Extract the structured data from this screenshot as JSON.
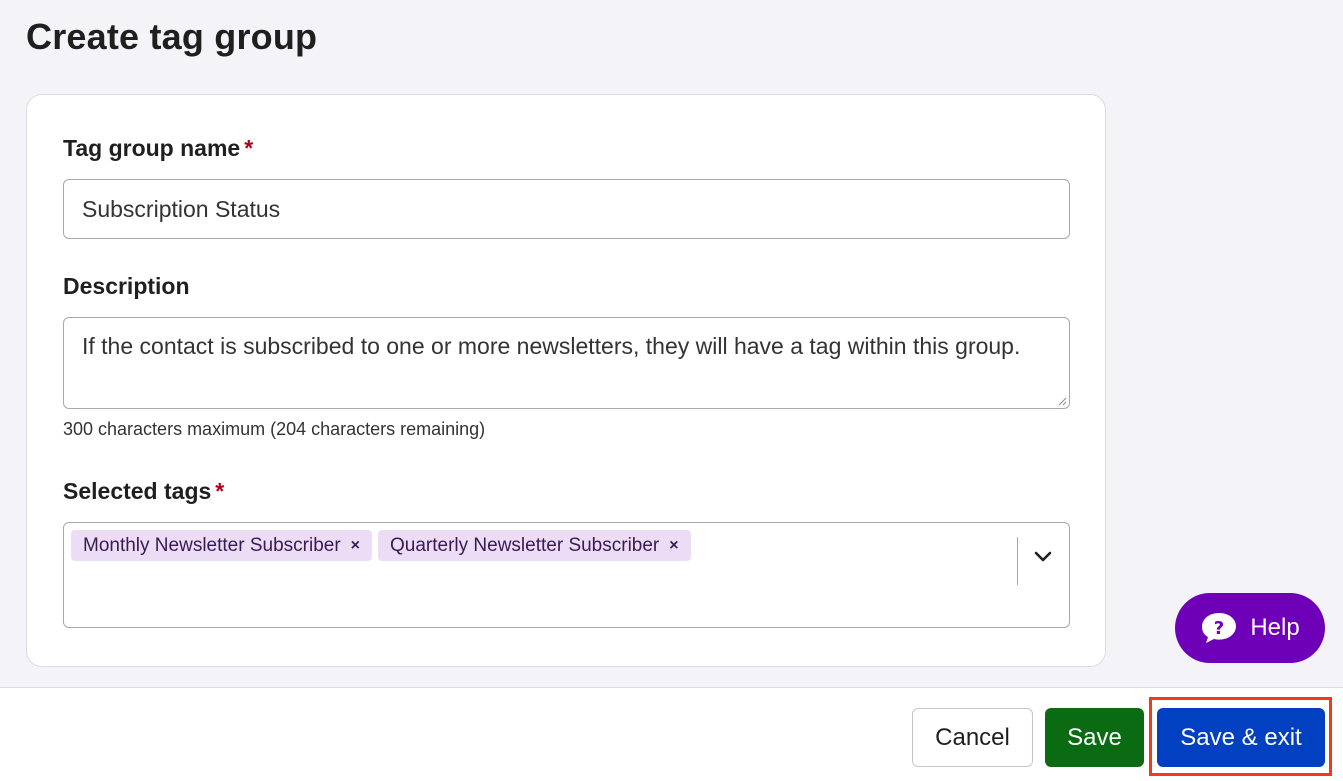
{
  "page": {
    "title": "Create tag group"
  },
  "form": {
    "name": {
      "label": "Tag group name",
      "required_mark": "*",
      "value": "Subscription Status"
    },
    "description": {
      "label": "Description",
      "value": "If the contact is subscribed to one or more newsletters, they will have a tag within this group.",
      "helper": "300 characters maximum (204 characters remaining)"
    },
    "tags": {
      "label": "Selected tags",
      "required_mark": "*",
      "selected": [
        {
          "label": "Monthly Newsletter Subscriber",
          "remove": "×"
        },
        {
          "label": "Quarterly Newsletter Subscriber",
          "remove": "×"
        }
      ]
    }
  },
  "help": {
    "label": "Help",
    "icon": "question-bubble-icon"
  },
  "footer": {
    "cancel": "Cancel",
    "save": "Save",
    "save_exit": "Save & exit"
  },
  "colors": {
    "primary": "#0040c1",
    "save": "#0b6b12",
    "help": "#6e00b8",
    "chip": "#ecdcf6",
    "required": "#b3001b",
    "highlight": "#ef3a1c"
  }
}
